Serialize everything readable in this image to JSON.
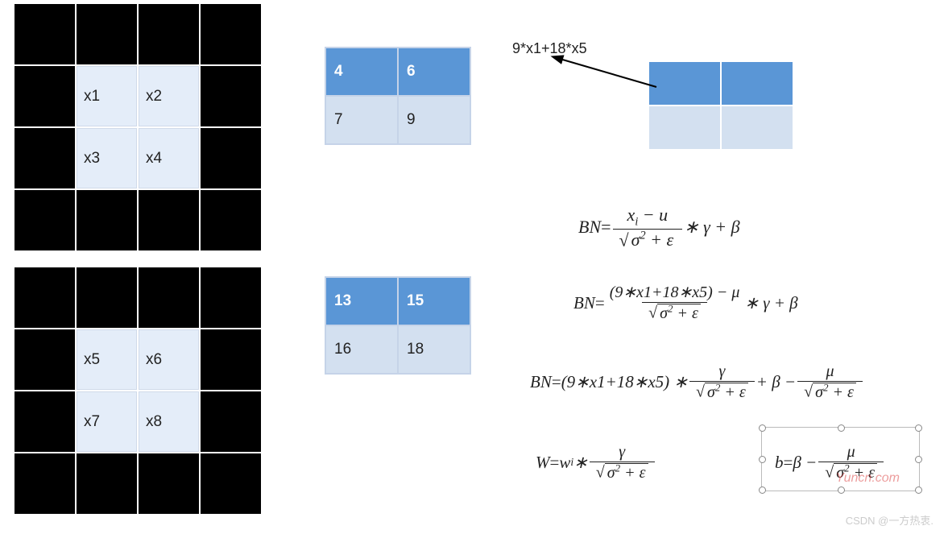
{
  "grid1": {
    "cells": [
      "x1",
      "x2",
      "x3",
      "x4"
    ]
  },
  "grid2": {
    "cells": [
      "x5",
      "x6",
      "x7",
      "x8"
    ]
  },
  "kernel1": [
    "4",
    "6",
    "7",
    "9"
  ],
  "kernel2": [
    "13",
    "15",
    "16",
    "18"
  ],
  "annotation": "9*x1+18*x5",
  "formulas": {
    "bn1_lhs": "BN",
    "bn1_num": "xᵢ − u",
    "bn1_den": "√(σ² + ε)",
    "bn1_tail": " ∗ γ + β",
    "bn2_lhs": "BN",
    "bn2_num": "(9∗x1+18∗x5) − μ",
    "bn2_den": "√(σ² + ε)",
    "bn2_tail": " ∗ γ + β",
    "bn3_lhs": "BN",
    "bn3_head": "(9∗x1+18∗x5) ∗ ",
    "bn3_f1num": "γ",
    "bn3_f1den": "√(σ² + ε)",
    "bn3_mid": " + β − ",
    "bn3_f2num": "μ",
    "bn3_f2den": "√(σ² + ε)",
    "w_lhs": "W",
    "w_head": "wᵢ ∗ ",
    "w_num": "γ",
    "w_den": "√(σ² + ε)",
    "b_lhs": "b",
    "b_head": "β − ",
    "b_num": "μ",
    "b_den": "√(σ² + ε)"
  },
  "eq": "=",
  "watermark": "CSDN @一方热衷.",
  "wm2": "Yuncn.com"
}
